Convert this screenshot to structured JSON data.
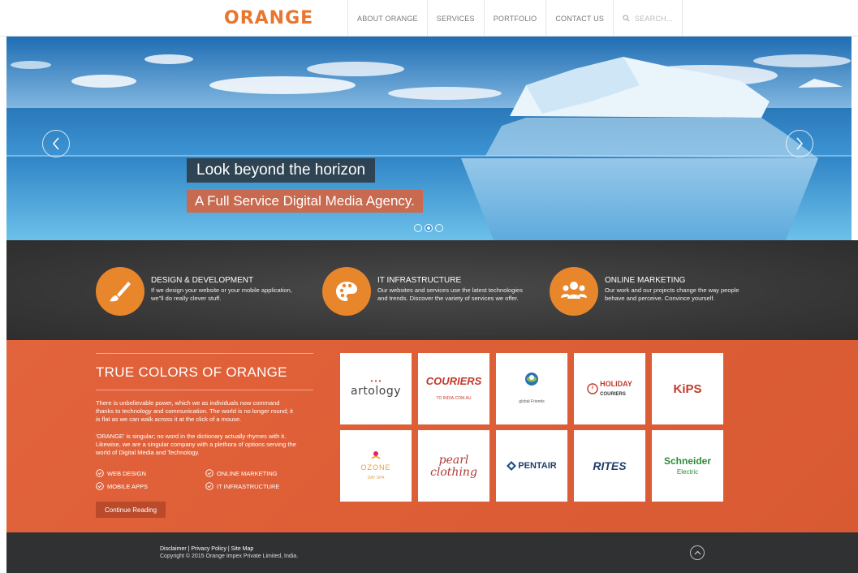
{
  "header": {
    "logo": "ORANGE",
    "nav": [
      "ABOUT ORANGE",
      "SERVICES",
      "PORTFOLIO",
      "CONTACT US"
    ],
    "search_placeholder": "SEARCH..."
  },
  "hero": {
    "caption_primary": "Look beyond the horizon",
    "caption_secondary": "A Full Service Digital Media Agency.",
    "slide_count": 3,
    "active_slide": 2
  },
  "services": [
    {
      "title": "DESIGN & DEVELOPMENT",
      "desc_line1": "If we design your website or your mobile application,",
      "desc_line2": "we\"ll do really clever stuff.",
      "icon": "paintbrush-icon"
    },
    {
      "title": "IT INFRASTRUCTURE",
      "desc_line1": "Our websites and services use the latest technologies",
      "desc_line2": "and trends. Discover the variety of services we offer.",
      "icon": "palette-icon"
    },
    {
      "title": "ONLINE MARKETING",
      "desc_line1": "Our work and our projects change the way people",
      "desc_line2": "behave and perceive. Convince yourself.",
      "icon": "people-icon"
    }
  ],
  "true_colors": {
    "title": "TRUE COLORS OF ORANGE",
    "p1_l1": "There is unbelievable power, which we as individuals now command",
    "p1_l2": "thanks to technology and communication. The world is no longer round; it",
    "p1_l3": "is flat as we can walk across it at the click of a mouse.",
    "p2_l1": "'ORANGE' is singular; no word in the dictionary actually rhymes with it.",
    "p2_l2": "Likewise, we are a singular company with a plethora of options serving the",
    "p2_l3": "world of Digital Media and Technology.",
    "checks": [
      "WEB DESIGN",
      "ONLINE MARKETING",
      "MOBILE APPS",
      "IT INFRASTRUCTURE"
    ],
    "button": "Continue Reading"
  },
  "clients": {
    "artology": "artology",
    "couriers": "COURIERS",
    "couriers_sub": "TO INDIA.COM.AU",
    "global": "global Friends",
    "holiday": "HOLIDAY",
    "holiday_sub": "COURIERS",
    "kips": "KiPS",
    "ozone": "OZONE",
    "ozone_sub": "DAY SPA",
    "pearl1": "pearl",
    "pearl2": "clothing",
    "pentair": "PENTAIR",
    "rites": "RITES",
    "schneider1": "Schneider",
    "schneider2": "Electric"
  },
  "footer": {
    "links": "Disclaimer  |  Privacy Policy  |  Site Map",
    "copyright": "Copyright © 2015 Orange Impex Private Limited, India."
  },
  "colors": {
    "accent": "#e8862c",
    "brand_orange": "#de5e36",
    "dark": "#353535"
  }
}
